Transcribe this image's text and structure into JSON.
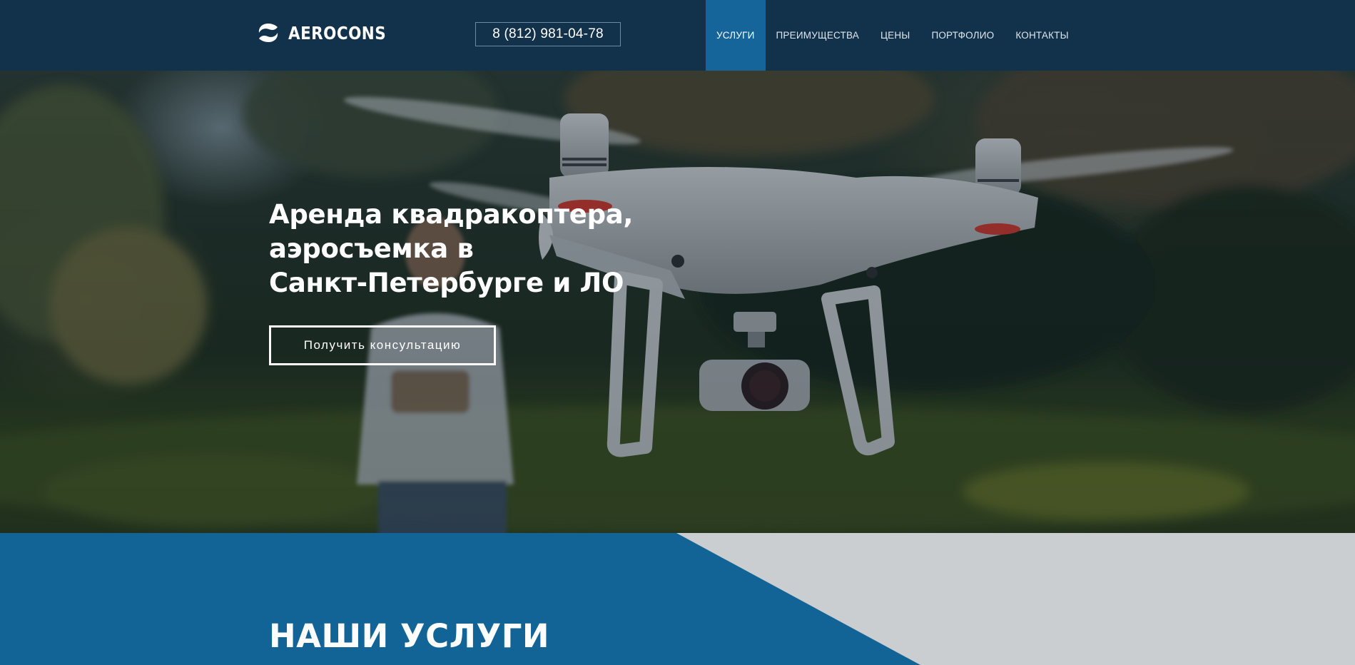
{
  "brand": {
    "name": "AEROCONS",
    "logo_icon": "aerocons-swirl-logo"
  },
  "header": {
    "phone": "8 (812) 981-04-78",
    "nav": [
      {
        "label": "УСЛУГИ",
        "active": true
      },
      {
        "label": "ПРЕИМУЩЕСТВА",
        "active": false
      },
      {
        "label": "ЦЕНЫ",
        "active": false
      },
      {
        "label": "ПОРТФОЛИО",
        "active": false
      },
      {
        "label": "КОНТАКТЫ",
        "active": false
      }
    ]
  },
  "hero": {
    "title_lines": [
      "Аренда квадракоптера,",
      "аэросъемка в",
      "Санкт-Петербурге и ЛО"
    ],
    "cta_label": "Получить консультацию",
    "image": "drone-photo"
  },
  "services": {
    "title": "НАШИ УСЛУГИ"
  },
  "colors": {
    "header_bg": "#12314a",
    "nav_active": "#16659a",
    "services_blue": "#126497",
    "services_gray": "#cbced1"
  }
}
